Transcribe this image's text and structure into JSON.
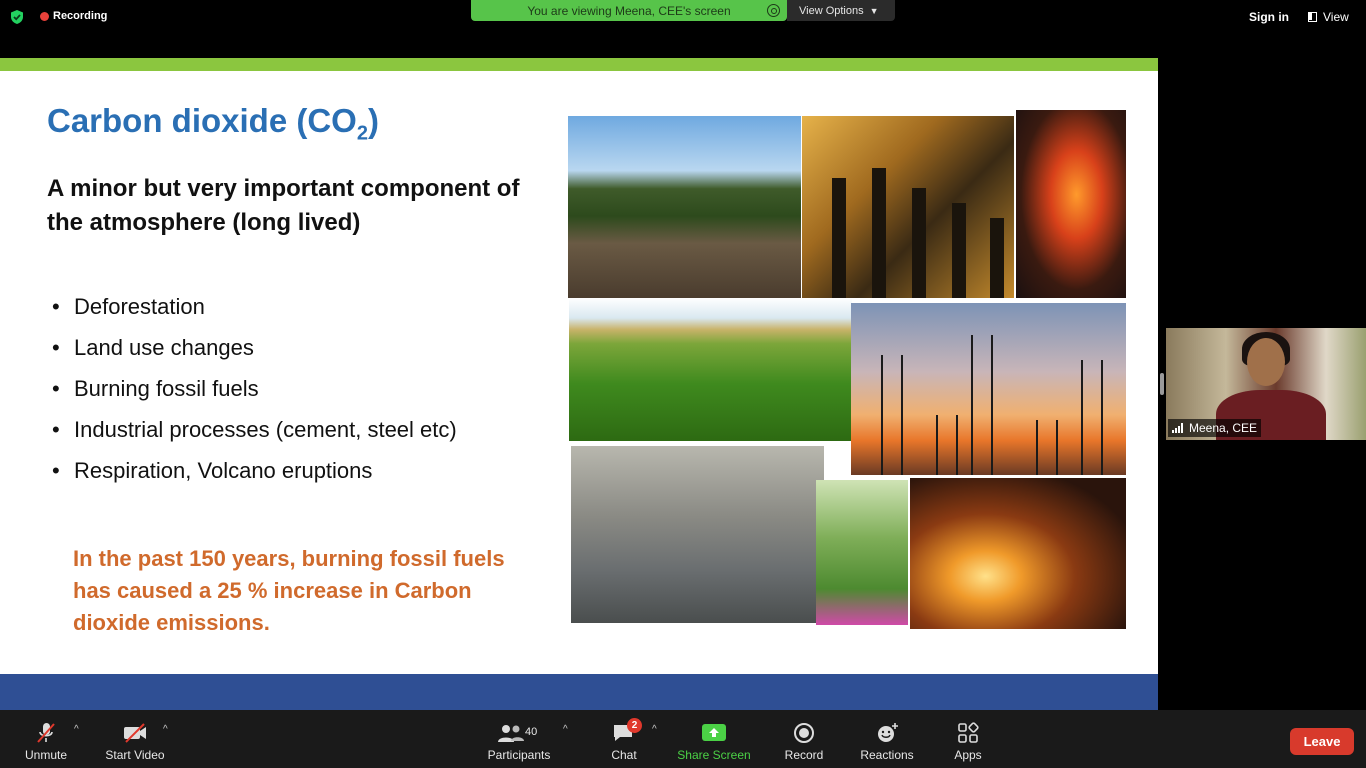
{
  "top_bar": {
    "recording_label": "Recording",
    "viewing_banner": "You are viewing Meena, CEE's screen",
    "view_options_label": "View Options",
    "sign_in_label": "Sign in",
    "view_label": "View"
  },
  "slide": {
    "title": "Carbon dioxide (CO",
    "title_subscript": "2",
    "title_suffix": ")",
    "subtitle": "A minor but very important component of the atmosphere (long lived)",
    "bullets": [
      "Deforestation",
      "Land use changes",
      "Burning fossil fuels",
      "Industrial processes (cement, steel etc)",
      "Respiration, Volcano eruptions"
    ],
    "callout": "In the past 150 years, burning fossil fuels has caused a 25 % increase in Carbon dioxide emissions."
  },
  "participant_video": {
    "name": "Meena, CEE"
  },
  "toolbar": {
    "unmute_label": "Unmute",
    "start_video_label": "Start Video",
    "participants_label": "Participants",
    "participants_count": "40",
    "chat_label": "Chat",
    "chat_badge": "2",
    "share_screen_label": "Share Screen",
    "record_label": "Record",
    "reactions_label": "Reactions",
    "apps_label": "Apps",
    "leave_label": "Leave"
  },
  "colors": {
    "slide_title": "#2a6fb4",
    "callout": "#d06a2c",
    "green_bar": "#8bc63f",
    "blue_bar": "#2f4f94",
    "share_screen": "#4bd146",
    "leave": "#d83a2c"
  }
}
